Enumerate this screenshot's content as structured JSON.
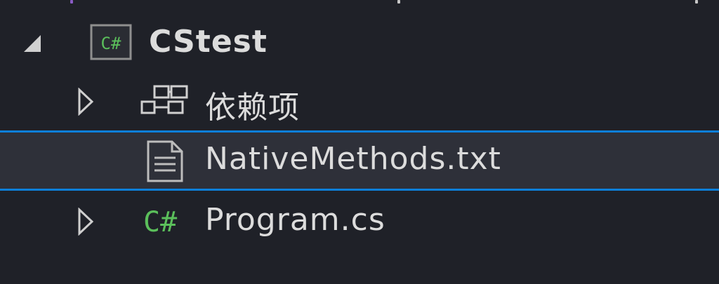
{
  "solution_explorer": {
    "project": {
      "name": "CStest",
      "icon": "csharp-project-icon",
      "expander": "expanded-triangle-icon"
    },
    "items": [
      {
        "label": "依赖项",
        "icon": "dependencies-icon",
        "expander": "collapsed-triangle-icon"
      },
      {
        "label": "NativeMethods.txt",
        "icon": "text-file-icon",
        "selected": true
      },
      {
        "label": "Program.cs",
        "icon": "csharp-file-icon",
        "expander": "collapsed-triangle-icon"
      }
    ]
  },
  "colors": {
    "background": "#1f2128",
    "selection_border": "#0d7fd9",
    "selection_fill": "#2e3039",
    "csharp_green": "#5bbf5b",
    "text": "#dcdcdc"
  }
}
